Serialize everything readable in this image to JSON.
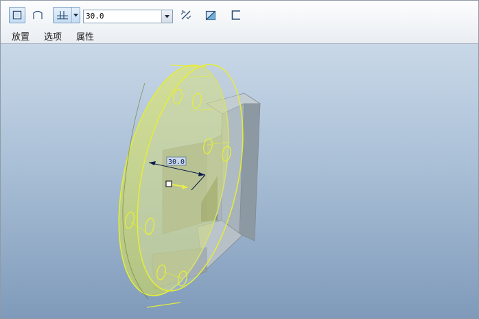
{
  "dashboard": {
    "mode_buttons": [
      {
        "icon": "solid-rectangle-icon",
        "active": true
      },
      {
        "icon": "surface-icon",
        "active": false
      }
    ],
    "depth_option": {
      "icon": "blind-depth-icon",
      "arrow_icon": "chevron-down-icon"
    },
    "depth_value": "30.0",
    "flip_button": {
      "icon": "flip-direction-icon"
    },
    "remove_material_button": {
      "icon": "remove-material-icon"
    },
    "thicken_button": {
      "icon": "thicken-sketch-icon"
    },
    "tabs": [
      {
        "label": "放置"
      },
      {
        "label": "选项"
      },
      {
        "label": "属性"
      }
    ]
  },
  "viewport": {
    "dimension_label": "30.0"
  },
  "colors": {
    "highlight": "#e4ec3a",
    "part_fill": "#9aa6ae",
    "part_face": "#b4bec6"
  }
}
